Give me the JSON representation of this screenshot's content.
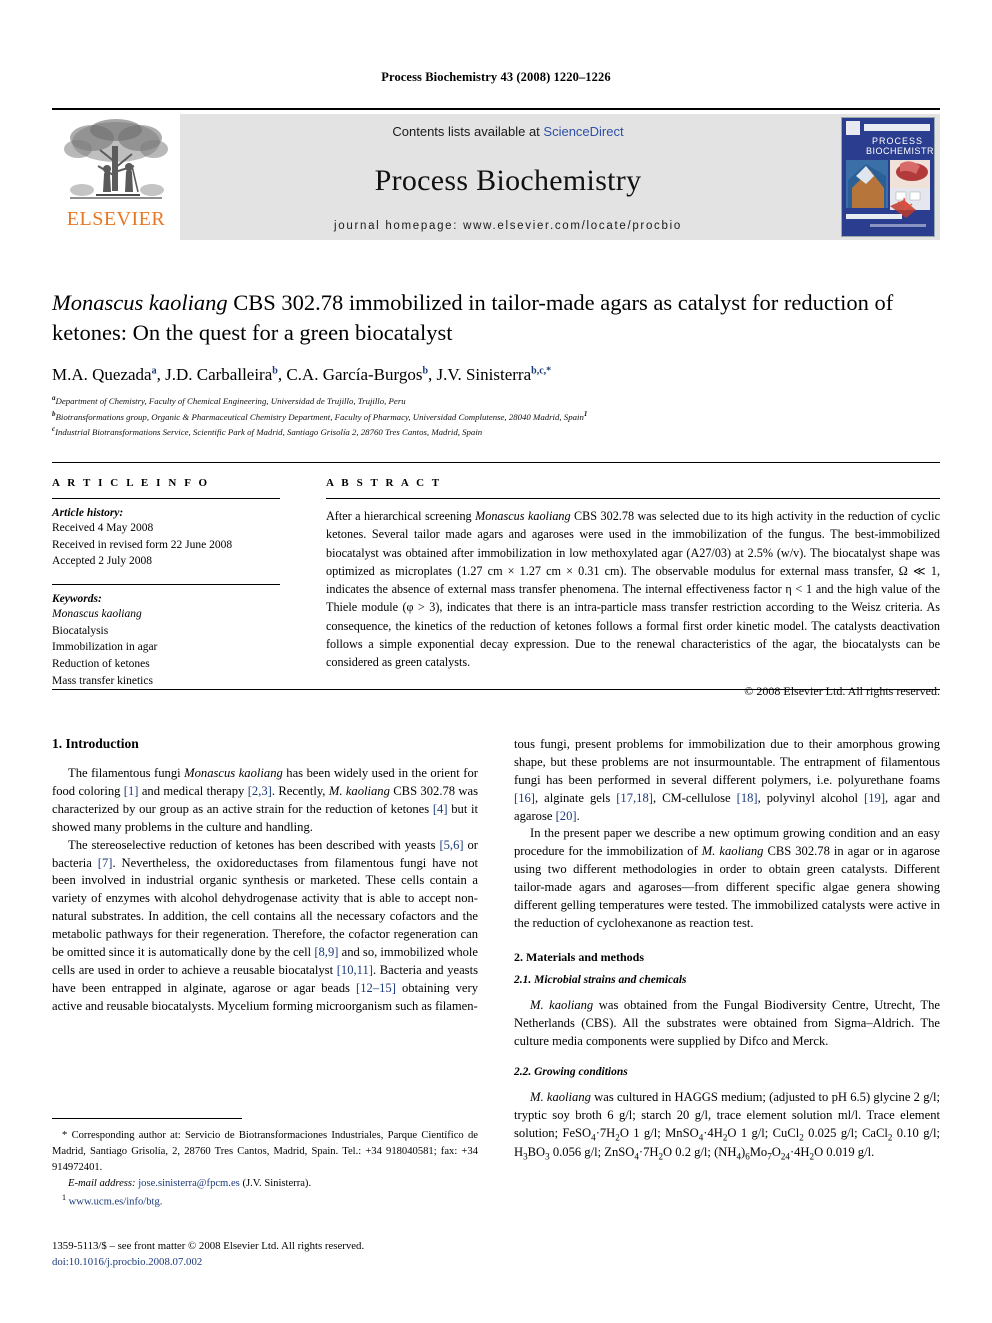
{
  "running_head": "Process Biochemistry 43 (2008) 1220–1226",
  "masthead": {
    "contents_prefix": "Contents lists available at ",
    "sciencedirect": "ScienceDirect",
    "journal_title": "Process Biochemistry",
    "homepage": "journal homepage: www.elsevier.com/locate/procbio",
    "publisher": "ELSEVIER",
    "publisher_color": "#E87722",
    "cover_title_line1": "PROCESS",
    "cover_title_line2": "BIOCHEMISTRY",
    "link_color": "#2f4fa8"
  },
  "title": {
    "part1_italic": "Monascus kaoliang",
    "part2": " CBS 302.78 immobilized in tailor-made agars as catalyst for reduction of ketones: On the quest for a green biocatalyst"
  },
  "authors": [
    {
      "name": "M.A. Quezada",
      "sup": "a"
    },
    {
      "name": "J.D. Carballeira",
      "sup": "b"
    },
    {
      "name": "C.A. García-Burgos",
      "sup": "b"
    },
    {
      "name": "J.V. Sinisterra",
      "sup": "b,c,*"
    }
  ],
  "affiliations": [
    {
      "mark": "a",
      "text": "Department of Chemistry, Faculty of Chemical Engineering, Universidad de Trujillo, Trujillo, Peru"
    },
    {
      "mark": "b",
      "text": "Biotransformations group, Organic & Pharmaceutical Chemistry Department, Faculty of Pharmacy, Universidad Complutense, 28040 Madrid, Spain",
      "trailing_sup": "1"
    },
    {
      "mark": "c",
      "text": "Industrial Biotransformations Service, Scientific Park of Madrid, Santiago Grisolía 2, 28760 Tres Cantos, Madrid, Spain"
    }
  ],
  "article_info": {
    "label": "A R T I C L E   I N F O",
    "history_head": "Article history:",
    "history": [
      "Received 4 May 2008",
      "Received in revised form 22 June 2008",
      "Accepted 2 July 2008"
    ],
    "keywords_head": "Keywords:",
    "keywords": [
      {
        "text": "Monascus kaoliang",
        "italic": true
      },
      {
        "text": "Biocatalysis",
        "italic": false
      },
      {
        "text": "Immobilization in agar",
        "italic": false
      },
      {
        "text": "Reduction of ketones",
        "italic": false
      },
      {
        "text": "Mass transfer kinetics",
        "italic": false
      }
    ]
  },
  "abstract": {
    "label": "A B S T R A C T",
    "paragraph_pre": "After a hierarchical screening ",
    "organism": "Monascus kaoliang",
    "paragraph_post": " CBS 302.78 was selected due to its high activity in the reduction of cyclic ketones. Several tailor made agars and agaroses were used in the immobilization of the fungus. The best-immobilized biocatalyst was obtained after immobilization in low methoxylated agar (A27/03) at 2.5% (w/v). The biocatalyst shape was optimized as microplates (1.27 cm × 1.27 cm × 0.31 cm). The observable modulus for external mass transfer, Ω ≪ 1, indicates the absence of external mass transfer phenomena. The internal effectiveness factor η < 1 and the high value of the Thiele module (φ > 3), indicates that there is an intra-particle mass transfer restriction according to the Weisz criteria. As consequence, the kinetics of the reduction of ketones follows a formal first order kinetic model. The catalysts deactivation follows a simple exponential decay expression. Due to the renewal characteristics of the agar, the biocatalysts can be considered as green catalysts.",
    "copyright": "© 2008 Elsevier Ltd. All rights reserved."
  },
  "sections": {
    "introduction_heading": "1. Introduction",
    "intro_p1_a": "The filamentous fungi ",
    "intro_p1_organism": "Monascus kaoliang",
    "intro_p1_b": " has been widely used in the orient for food coloring ",
    "intro_p1_ref1": "[1]",
    "intro_p1_c": " and medical therapy ",
    "intro_p1_ref2": "[2,3]",
    "intro_p1_d": ". Recently, ",
    "intro_p1_organism2": "M. kaoliang",
    "intro_p1_e": " CBS 302.78 was characterized by our group as an active strain for the reduction of ketones ",
    "intro_p1_ref3": "[4]",
    "intro_p1_f": " but it showed many problems in the culture and handling.",
    "intro_p2_a": "The stereoselective reduction of ketones has been described with yeasts ",
    "intro_p2_ref1": "[5,6]",
    "intro_p2_b": " or bacteria ",
    "intro_p2_ref2": "[7]",
    "intro_p2_c": ". Nevertheless, the oxidoreductases from filamentous fungi have not been involved in industrial organic synthesis or marketed. These cells contain a variety of enzymes with alcohol dehydrogenase activity that is able to accept non-natural substrates. In addition, the cell contains all the necessary cofactors and the metabolic pathways for their regeneration. Therefore, the cofactor regeneration can be omitted since it is automatically done by the cell ",
    "intro_p2_ref3": "[8,9]",
    "intro_p2_d": " and so, immobilized whole cells are used in order to achieve a reusable biocatalyst ",
    "intro_p2_ref4": "[10,11]",
    "intro_p2_e": ". Bacteria and yeasts have been entrapped in alginate, agarose or agar beads ",
    "intro_p2_ref5": "[12–15]",
    "intro_p2_f": " obtaining very active and reusable biocatalysts. Mycelium forming microorganism such as filamen-",
    "intro_p3_a": "tous fungi, present problems for immobilization due to their amorphous growing shape, but these problems are not insurmountable. The entrapment of filamentous fungi has been performed in several different polymers, i.e. polyurethane foams ",
    "intro_p3_ref1": "[16]",
    "intro_p3_b": ", alginate gels ",
    "intro_p3_ref2": "[17,18]",
    "intro_p3_c": ", CM-cellulose ",
    "intro_p3_ref3": "[18]",
    "intro_p3_d": ", polyvinyl alcohol ",
    "intro_p3_ref4": "[19]",
    "intro_p3_e": ", agar and agarose ",
    "intro_p3_ref5": "[20]",
    "intro_p3_f": ".",
    "intro_p4_a": "In the present paper we describe a new optimum growing condition and an easy procedure for the immobilization of ",
    "intro_p4_organism": "M. kaoliang",
    "intro_p4_b": " CBS 302.78 in agar or in agarose using two different methodologies in order to obtain green catalysts. Different tailor-made agars and agaroses—from different specific algae genera showing different gelling temperatures were tested. The immobilized catalysts were active in the reduction of cyclohexanone as reaction test.",
    "materials_heading": "2. Materials and methods",
    "sub21_heading": "2.1. Microbial strains and chemicals",
    "sub21_organism": "M. kaoliang",
    "sub21_text": " was obtained from the Fungal Biodiversity Centre, Utrecht, The Netherlands (CBS). All the substrates were obtained from Sigma–Aldrich. The culture media components were supplied by Difco and Merck.",
    "sub22_heading": "2.2. Growing conditions",
    "sub22_organism": "M. kaoliang",
    "sub22_text_a": " was cultured in HAGGS medium; (adjusted to pH 6.5) glycine 2 g/l; tryptic soy broth 6 g/l; starch 20 g/l, trace element solution ml/l. Trace element solution; FeSO",
    "sub22_text_b": "·7H",
    "sub22_text_c": "O 1 g/l; MnSO",
    "sub22_text_d": "·4H",
    "sub22_text_e": "O 1 g/l; CuCl",
    "sub22_text_f": " 0.025 g/l; CaCl",
    "sub22_text_g": " 0.10 g/l; H",
    "sub22_text_h": "BO",
    "sub22_text_i": " 0.056 g/l; ZnSO",
    "sub22_text_j": "·7H",
    "sub22_text_k": "O 0.2 g/l; (NH",
    "sub22_text_l": ")",
    "sub22_text_m": "Mo",
    "sub22_text_n": "O",
    "sub22_text_o": "·4H",
    "sub22_text_p": "O 0.019 g/l."
  },
  "footnotes": {
    "corresponding": "* Corresponding author at: Servicio de Biotransformaciones Industriales, Parque Científico de Madrid, Santiago Grisolía, 2, 28760 Tres Cantos, Madrid, Spain. Tel.: +34 918040581; fax: +34 914972401.",
    "email_label": "E-mail address:",
    "email": "jose.sinisterra@fpcm.es",
    "email_author": "(J.V. Sinisterra).",
    "note_mark": "1",
    "note_url": "www.ucm.es/info/btg."
  },
  "footer": {
    "issn": "1359-5113/$ – see front matter © 2008 Elsevier Ltd. All rights reserved.",
    "doi": "doi:10.1016/j.procbio.2008.07.002"
  }
}
